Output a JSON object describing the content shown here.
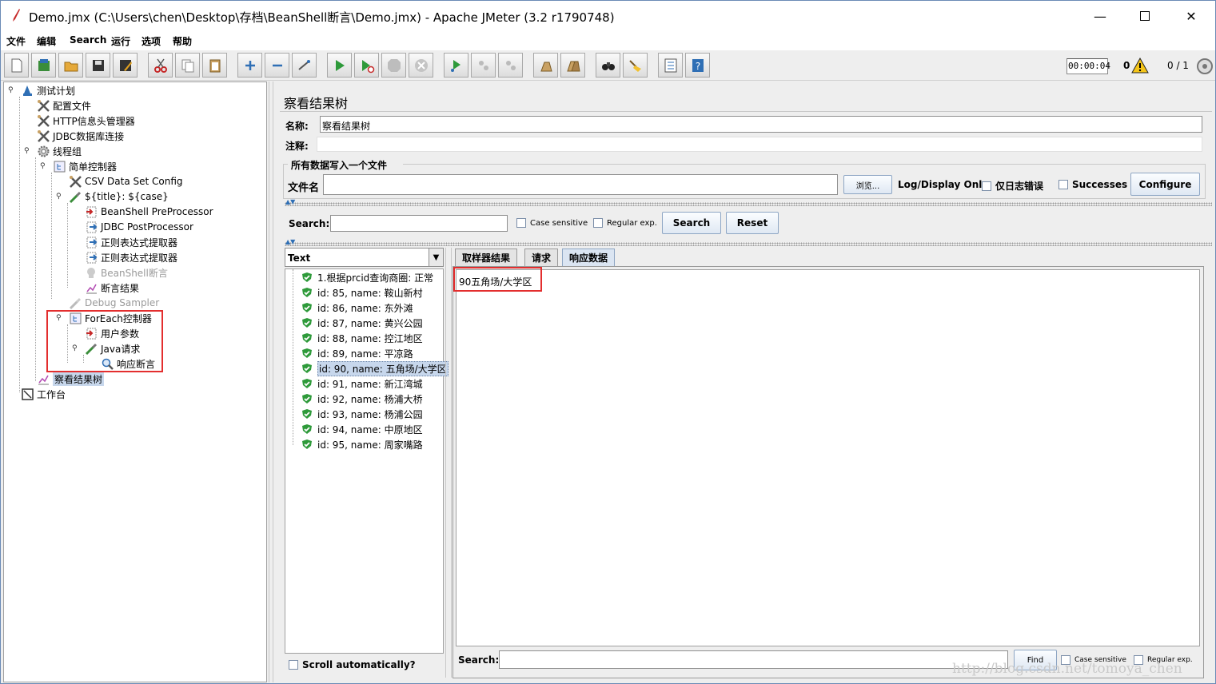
{
  "window": {
    "title": "Demo.jmx (C:\\Users\\chen\\Desktop\\存档\\BeanShell断言\\Demo.jmx) - Apache JMeter (3.2 r1790748)"
  },
  "menu": [
    "文件",
    "编辑",
    "Search",
    "运行",
    "选项",
    "帮助"
  ],
  "toolbar": {
    "timer": "00:00:04",
    "warning_count": "0",
    "threads": "0 / 1"
  },
  "tree": [
    {
      "label": "测试计划",
      "icon": "test-plan-icon"
    },
    {
      "label": "配置文件",
      "icon": "config-tools-icon"
    },
    {
      "label": "HTTP信息头管理器",
      "icon": "config-tools-icon"
    },
    {
      "label": "JDBC数据库连接",
      "icon": "config-tools-icon"
    },
    {
      "label": "线程组",
      "icon": "gear-icon"
    },
    {
      "label": "简单控制器",
      "icon": "controller-icon"
    },
    {
      "label": "CSV Data Set Config",
      "icon": "config-tools-icon"
    },
    {
      "label": "${title}: ${case}",
      "icon": "sampler-pipette-icon"
    },
    {
      "label": "BeanShell PreProcessor",
      "icon": "preprocessor-icon"
    },
    {
      "label": "JDBC PostProcessor",
      "icon": "postprocessor-icon"
    },
    {
      "label": "正则表达式提取器",
      "icon": "postprocessor-icon"
    },
    {
      "label": "正则表达式提取器",
      "icon": "postprocessor-icon"
    },
    {
      "label": "BeanShell断言",
      "icon": "assertion-disabled-icon"
    },
    {
      "label": "断言结果",
      "icon": "listener-graph-icon"
    },
    {
      "label": "Debug Sampler",
      "icon": "sampler-pipette-icon"
    },
    {
      "label": "ForEach控制器",
      "icon": "controller-icon"
    },
    {
      "label": "用户参数",
      "icon": "preprocessor-icon"
    },
    {
      "label": "Java请求",
      "icon": "sampler-pipette-icon"
    },
    {
      "label": "响应断言",
      "icon": "magnifier-icon"
    },
    {
      "label": "察看结果树",
      "icon": "listener-graph-icon"
    },
    {
      "label": "工作台",
      "icon": "workbench-icon"
    }
  ],
  "panel": {
    "title": "察看结果树",
    "name_label": "名称:",
    "name_value": "察看结果树",
    "comment_label": "注释:",
    "file_group_title": "所有数据写入一个文件",
    "filename_label": "文件名",
    "browse_label": "浏览...",
    "log_display_label": "Log/Display Only:",
    "errors_label": "仅日志错误",
    "successes_label": "Successes",
    "configure_label": "Configure"
  },
  "search": {
    "label": "Search:",
    "case_sensitive": "Case sensitive",
    "regex": "Regular exp.",
    "search_button": "Search",
    "reset_button": "Reset"
  },
  "renderer": {
    "selected": "Text"
  },
  "results": [
    "1.根据prcid查询商圈: 正常",
    "id: 85, name: 鞍山新村",
    "id: 86, name: 东外滩",
    "id: 87, name: 黄兴公园",
    "id: 88, name: 控江地区",
    "id: 89, name: 平凉路",
    "id: 90, name: 五角场/大学区",
    "id: 91, name: 新江湾城",
    "id: 92, name: 杨浦大桥",
    "id: 93, name: 杨浦公园",
    "id: 94, name: 中原地区",
    "id: 95, name: 周家嘴路"
  ],
  "scroll_auto_label": "Scroll automatically?",
  "tabs": [
    "取样器结果",
    "请求",
    "响应数据"
  ],
  "response_text": "90五角场/大学区",
  "bottom_search": {
    "label": "Search:",
    "find_button": "Find",
    "case_sensitive": "Case sensitive",
    "regex": "Regular exp."
  },
  "watermark": "http://blog.csdn.net/tomoya_chen",
  "colors": {
    "highlight_box": "#e32e2e",
    "selection": "#c7d7ec",
    "success_green": "#2e9a3a"
  }
}
